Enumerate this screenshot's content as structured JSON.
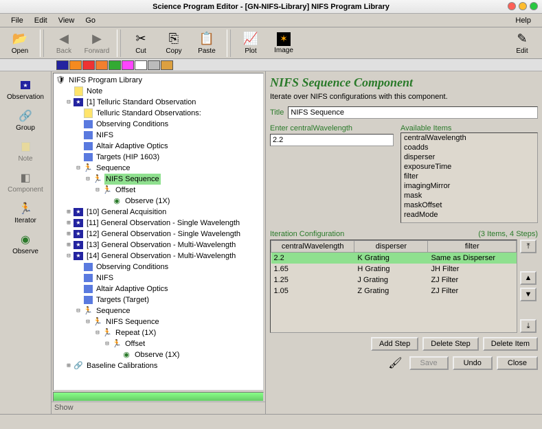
{
  "window": {
    "title": "Science Program Editor - [GN-NIFS-Library] NIFS Program Library"
  },
  "menubar": {
    "file": "File",
    "edit": "Edit",
    "view": "View",
    "go": "Go",
    "help": "Help"
  },
  "toolbar": {
    "open": "Open",
    "back": "Back",
    "forward": "Forward",
    "cut": "Cut",
    "copy": "Copy",
    "paste": "Paste",
    "plot": "Plot",
    "image": "Image",
    "editbtn": "Edit"
  },
  "palette": {
    "colors": [
      "#2323a0",
      "#f58a1f",
      "#e33",
      "#f27f2e",
      "#3a3",
      "#f4f",
      "#fff",
      "#bbb",
      "#dca"
    ]
  },
  "leftbar": {
    "observation": "Observation",
    "group": "Group",
    "note": "Note",
    "component": "Component",
    "iterator": "Iterator",
    "observe": "Observe"
  },
  "tree": {
    "root": "NIFS Program Library",
    "note": "Note",
    "obs1": "[1] Telluric Standard Observation",
    "obs1_note": "Telluric Standard Observations:",
    "cond": "Observing Conditions",
    "nifs": "NIFS",
    "altair": "Altair Adaptive Optics",
    "targets1": "Targets (HIP 1603)",
    "sequence": "Sequence",
    "nifs_seq": "NIFS Sequence",
    "offset": "Offset",
    "observe1x": "Observe (1X)",
    "obs10": "[10] General Acquisition",
    "obs11": "[11] General Observation - Single Wavelength",
    "obs12": "[12] General Observation - Single Wavelength",
    "obs13": "[13] General Observation - Multi-Wavelength",
    "obs14": "[14] General Observation - Multi-Wavelength",
    "targets2": "Targets (Target)",
    "repeat": "Repeat (1X)",
    "baseline": "Baseline Calibrations"
  },
  "show": "Show",
  "panel": {
    "title": "NIFS Sequence Component",
    "subtitle": "Iterate over NIFS configurations with this component.",
    "title_label": "Title",
    "title_value": "NIFS Sequence",
    "enter_label": "Enter centralWavelength",
    "enter_value": "2.2",
    "avail_label": "Available Items",
    "avail_items": [
      "centralWavelength",
      "coadds",
      "disperser",
      "exposureTime",
      "filter",
      "imagingMirror",
      "mask",
      "maskOffset",
      "readMode"
    ],
    "iter_label": "Iteration Configuration",
    "iter_count": "(3 Items, 4 Steps)",
    "table": {
      "cols": [
        "centralWavelength",
        "disperser",
        "filter"
      ],
      "rows": [
        {
          "cw": "2.2",
          "disp": "K Grating",
          "filt": "Same as Disperser"
        },
        {
          "cw": "1.65",
          "disp": "H Grating",
          "filt": "JH Filter"
        },
        {
          "cw": "1.25",
          "disp": "J Grating",
          "filt": "ZJ Filter"
        },
        {
          "cw": "1.05",
          "disp": "Z Grating",
          "filt": "ZJ Filter"
        }
      ]
    },
    "add_step": "Add Step",
    "delete_step": "Delete Step",
    "delete_item": "Delete Item",
    "save": "Save",
    "undo": "Undo",
    "close": "Close"
  }
}
